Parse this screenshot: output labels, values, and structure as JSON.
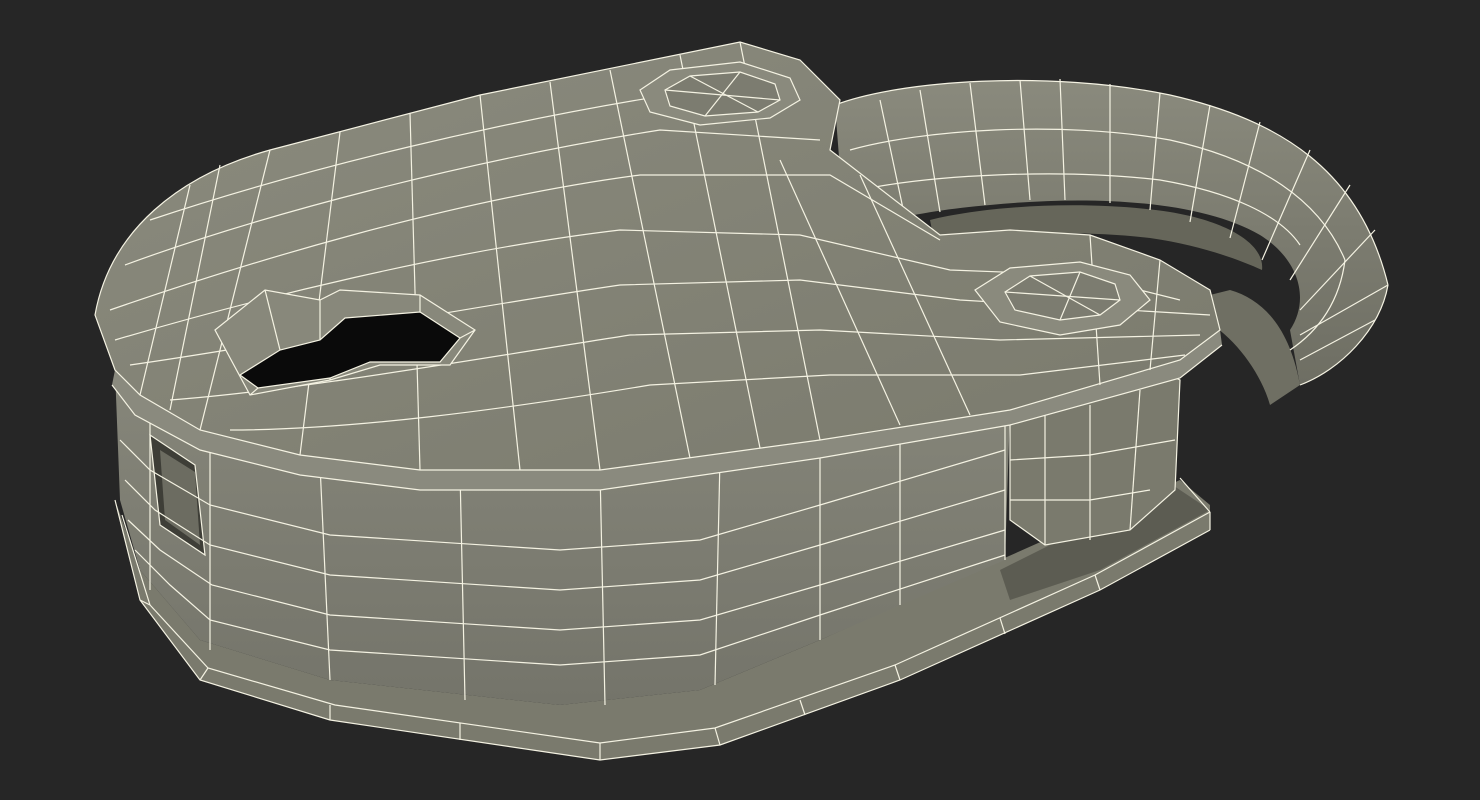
{
  "scene": {
    "subject": "padlock-wireframe-model",
    "icon": "padlock-icon",
    "colors": {
      "background": "#262626",
      "surface": "#7e7e70",
      "surface_light": "#8d8d80",
      "surface_dark": "#66665a",
      "shadow": "#4e4e45",
      "hole": "#0a0a0a",
      "wire": "#f4f2e2"
    }
  }
}
